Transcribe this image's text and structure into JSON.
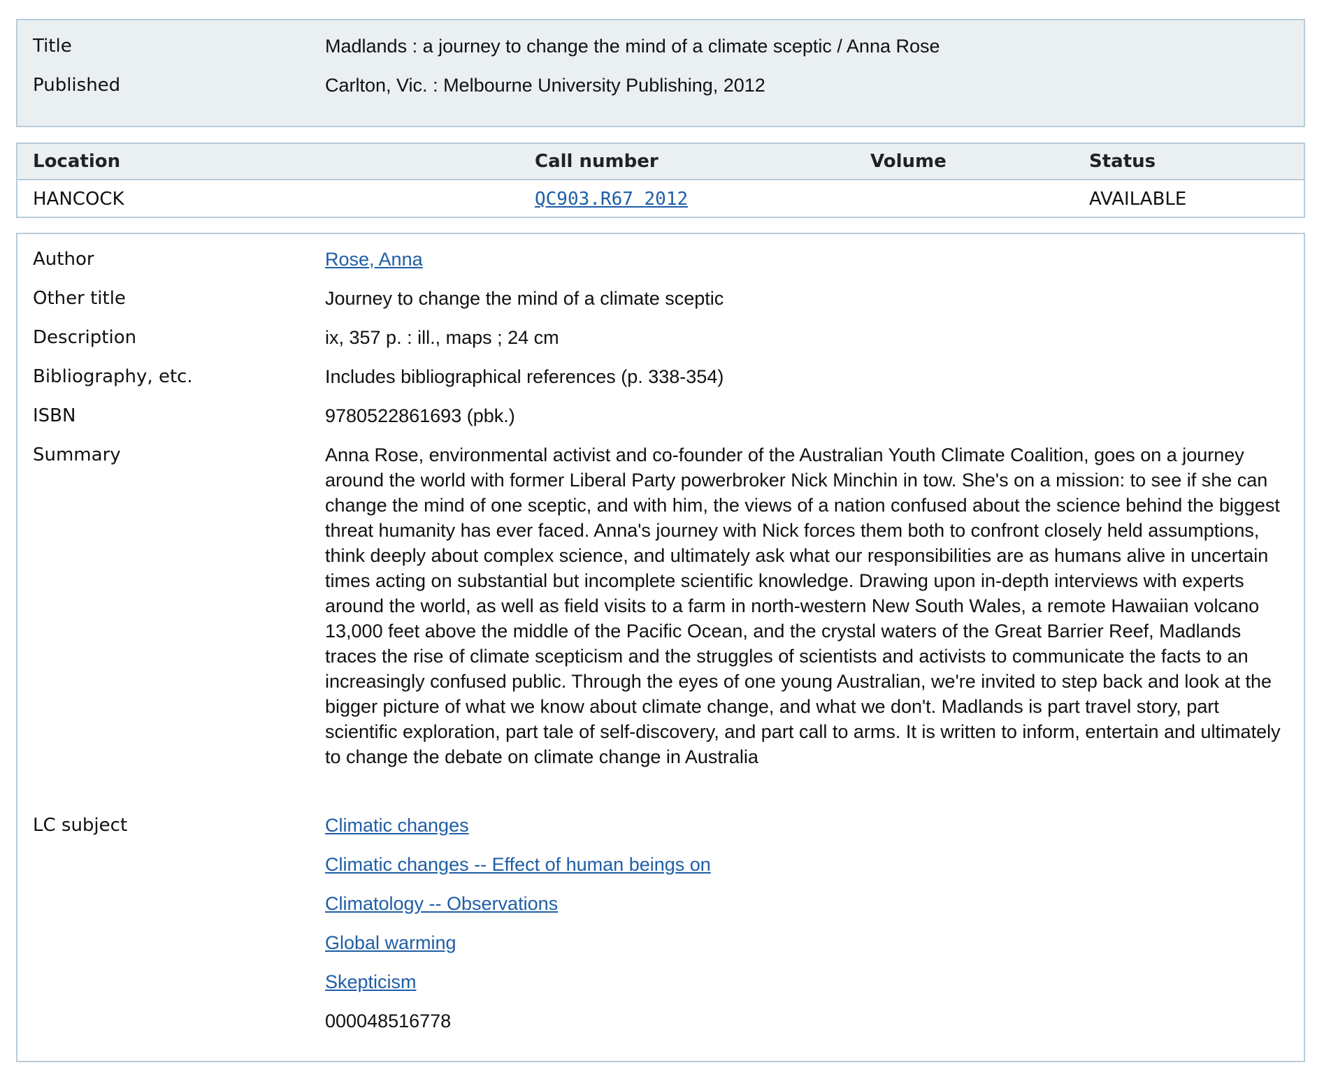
{
  "summary": {
    "rows": [
      {
        "label": "Title",
        "value": "Madlands : a journey to change the mind of a climate sceptic / Anna Rose"
      },
      {
        "label": "Published",
        "value": "Carlton, Vic. : Melbourne University Publishing, 2012"
      }
    ]
  },
  "holdings": {
    "columns": [
      "Location",
      "Call number",
      "Volume",
      "Status"
    ],
    "rows": [
      {
        "location": "HANCOCK",
        "call_number": "QC903.R67 2012",
        "volume": "",
        "status": "AVAILABLE"
      }
    ]
  },
  "details": {
    "author": {
      "label": "Author",
      "value": "Rose, Anna"
    },
    "other_title": {
      "label": "Other title",
      "value": "Journey to change the mind of a climate sceptic"
    },
    "description": {
      "label": "Description",
      "value": "ix, 357 p. : ill., maps ; 24 cm"
    },
    "bibliography": {
      "label": "Bibliography, etc.",
      "value": "Includes bibliographical references (p. 338-354)"
    },
    "isbn": {
      "label": "ISBN",
      "value": "9780522861693 (pbk.)"
    },
    "summary": {
      "label": "Summary",
      "value": "Anna Rose, environmental activist and co-founder of the Australian Youth Climate Coalition, goes on a journey around the world with former Liberal Party powerbroker Nick Minchin in tow. She's on a mission: to see if she can change the mind of one sceptic, and with him, the views of a nation confused about the science behind the biggest threat humanity has ever faced. Anna's journey with Nick forces them both to confront closely held assumptions, think deeply about complex science, and ultimately ask what our responsibilities are as humans alive in uncertain times acting on substantial but incomplete scientific knowledge. Drawing upon in-depth interviews with experts around the world, as well as field visits to a farm in north-western New South Wales, a remote Hawaiian volcano 13,000 feet above the middle of the Pacific Ocean, and the crystal waters of the Great Barrier Reef, Madlands traces the rise of climate scepticism and the struggles of scientists and activists to communicate the facts to an increasingly confused public. Through the eyes of one young Australian, we're invited to step back and look at the bigger picture of what we know about climate change, and what we don't. Madlands is part travel story, part scientific exploration, part tale of self-discovery, and part call to arms. It is written to inform, entertain and ultimately to change the debate on climate change in Australia"
    },
    "lc_subject": {
      "label": "LC subject",
      "links": [
        "Climatic changes",
        "Climatic changes -- Effect of human beings on",
        "Climatology -- Observations",
        "Global warming",
        "Skepticism"
      ]
    },
    "record_id": "000048516778"
  },
  "colors": {
    "panel_background": "#eaeff2",
    "panel_border": "#b9ccd8",
    "link": "#1f5ea6"
  }
}
